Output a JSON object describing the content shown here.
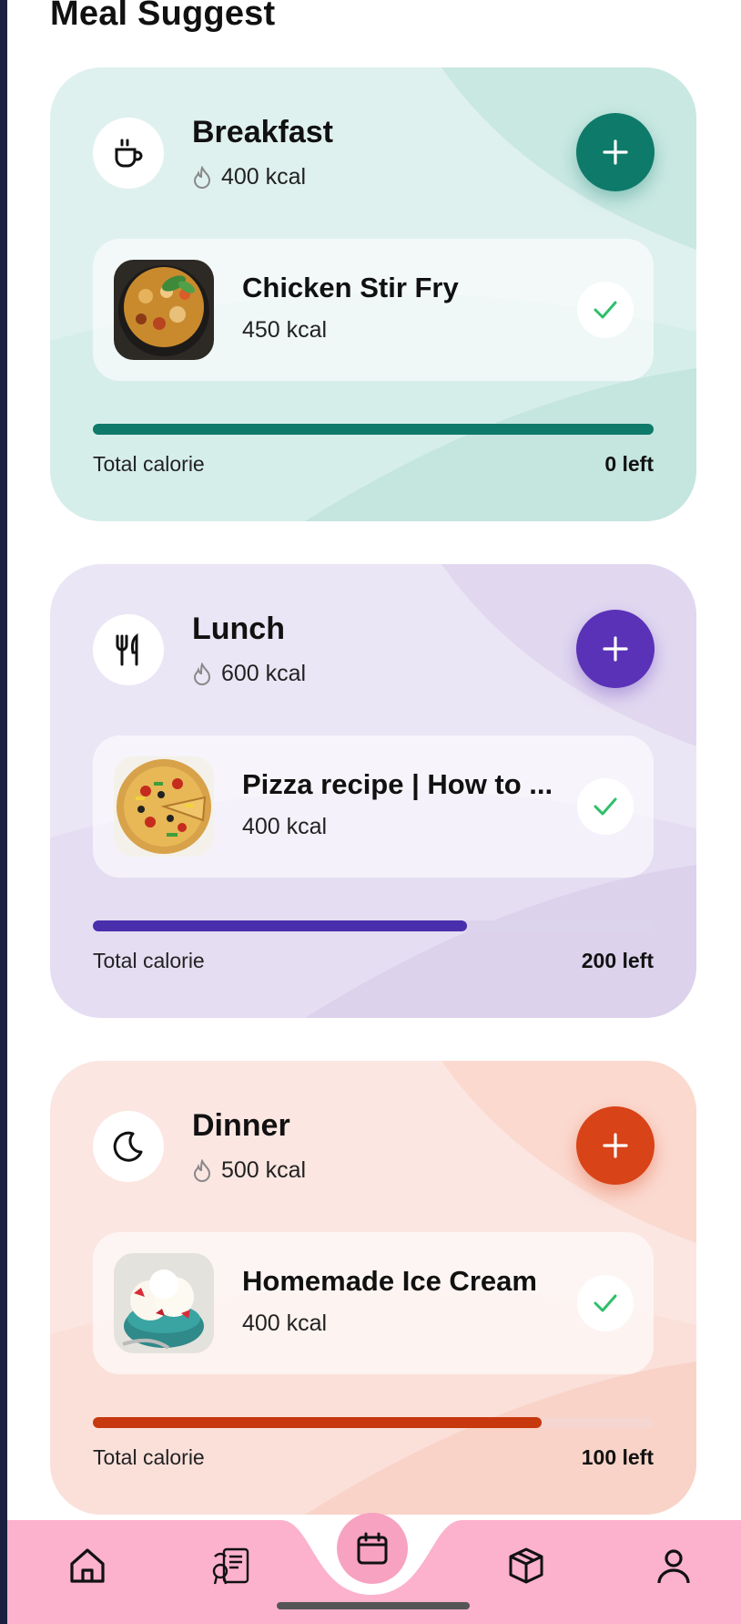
{
  "page": {
    "title": "Meal Suggest"
  },
  "meals": [
    {
      "name": "Breakfast",
      "kcal": "400 kcal",
      "icon": "coffee-cup-icon",
      "item": {
        "name": "Chicken Stir Fry",
        "kcal": "450 kcal",
        "image": "chicken-stir-fry-photo"
      },
      "progress_fraction": 1.0,
      "total_label": "Total calorie",
      "left_label": "0 left",
      "colors": {
        "bg": "#dff1ee",
        "accent": "#0e7a6a",
        "track": "#c0e3dc"
      }
    },
    {
      "name": "Lunch",
      "kcal": "600 kcal",
      "icon": "fork-knife-icon",
      "item": {
        "name": "Pizza recipe | How to ...",
        "kcal": "400 kcal",
        "image": "pizza-photo"
      },
      "progress_fraction": 0.667,
      "total_label": "Total calorie",
      "left_label": "200 left",
      "colors": {
        "bg": "#ebe6f5",
        "accent": "#4a2fad",
        "track": "#dcd4ec"
      }
    },
    {
      "name": "Dinner",
      "kcal": "500 kcal",
      "icon": "moon-icon",
      "item": {
        "name": "Homemade Ice Cream",
        "kcal": "400 kcal",
        "image": "ice-cream-photo"
      },
      "progress_fraction": 0.8,
      "total_label": "Total calorie",
      "left_label": "100 left",
      "colors": {
        "bg": "#fbe6e2",
        "accent": "#d2441c",
        "track": "#f5d6d0"
      }
    }
  ],
  "bottom_nav": {
    "items": [
      "home-icon",
      "recipe-icon",
      "calendar-icon",
      "box-icon",
      "profile-icon"
    ],
    "colors": {
      "bg": "#fcb1cc",
      "center": "#f7a2c1"
    }
  }
}
